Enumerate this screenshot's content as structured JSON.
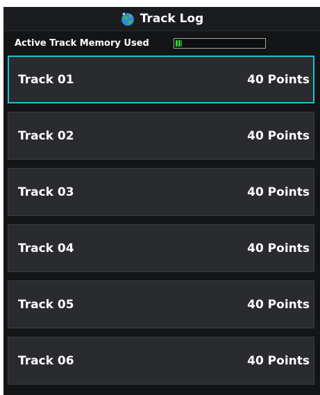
{
  "header": {
    "title": "Track Log",
    "icon": "globe-icon"
  },
  "memory": {
    "label": "Active Track Memory Used",
    "used_fraction": 0.07,
    "fill_color": "#2fd12f"
  },
  "tracks": [
    {
      "name": "Track 01",
      "points": "40 Points",
      "selected": true
    },
    {
      "name": "Track 02",
      "points": "40 Points",
      "selected": false
    },
    {
      "name": "Track 03",
      "points": "40 Points",
      "selected": false
    },
    {
      "name": "Track 04",
      "points": "40 Points",
      "selected": false
    },
    {
      "name": "Track 05",
      "points": "40 Points",
      "selected": false
    },
    {
      "name": "Track 06",
      "points": "40 Points",
      "selected": false
    }
  ],
  "colors": {
    "background": "#141517",
    "row": "#2a2b2e",
    "selection": "#1fc2d6"
  }
}
